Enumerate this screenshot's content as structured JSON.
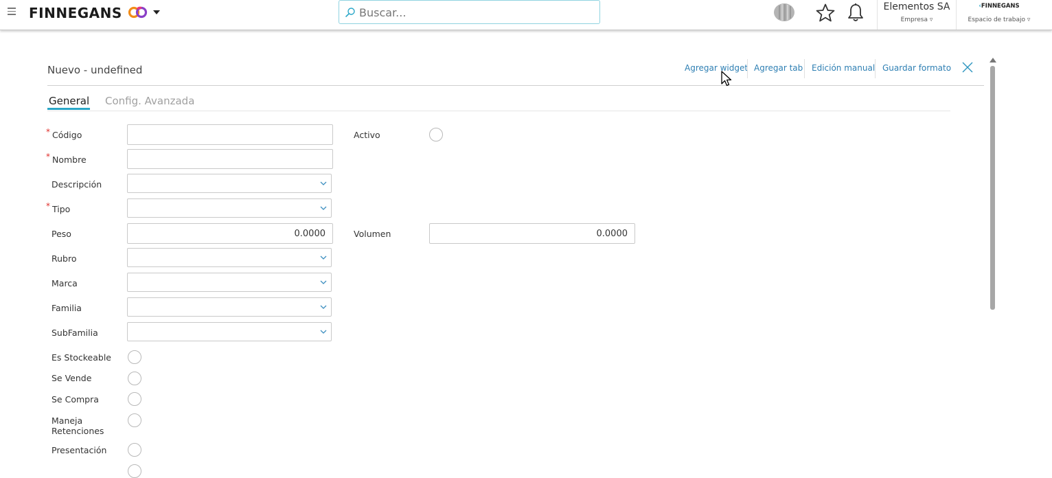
{
  "topbar": {
    "brand": "FINNEGANS",
    "search_placeholder": "Buscar...",
    "company_name": "Elementos SA",
    "company_label": "Empresa",
    "workspace_logo": "FINNEGANS",
    "workspace_label": "Espacio de trabajo"
  },
  "page": {
    "title": "Nuevo - undefined",
    "actions": [
      "Agregar widget",
      "Agregar tab",
      "Edición manual",
      "Guardar formato"
    ]
  },
  "tabs": [
    "General",
    "Config. Avanzada"
  ],
  "form": {
    "codigo": {
      "label": "Código",
      "value": ""
    },
    "nombre": {
      "label": "Nombre",
      "value": ""
    },
    "descripcion": {
      "label": "Descripción",
      "value": ""
    },
    "tipo": {
      "label": "Tipo",
      "value": ""
    },
    "peso": {
      "label": "Peso",
      "value": "0.0000"
    },
    "rubro": {
      "label": "Rubro",
      "value": ""
    },
    "marca": {
      "label": "Marca",
      "value": ""
    },
    "familia": {
      "label": "Familia",
      "value": ""
    },
    "subfamilia": {
      "label": "SubFamilia",
      "value": ""
    },
    "es_stockeable": {
      "label": "Es Stockeable"
    },
    "se_vende": {
      "label": "Se Vende"
    },
    "se_compra": {
      "label": "Se Compra"
    },
    "maneja_retenciones": {
      "label": "Maneja Retenciones"
    },
    "presentacion": {
      "label": "Presentación"
    },
    "activo": {
      "label": "Activo"
    },
    "volumen": {
      "label": "Volumen",
      "value": "0.0000"
    },
    "required_mark": "*"
  },
  "icons": {
    "menu": "hamburger-icon",
    "search": "search-icon",
    "star": "star-icon",
    "bell": "bell-icon",
    "close": "close-icon"
  },
  "colors": {
    "accent": "#2aa7c8",
    "link": "#2e7fb3",
    "required": "#e0302c"
  }
}
